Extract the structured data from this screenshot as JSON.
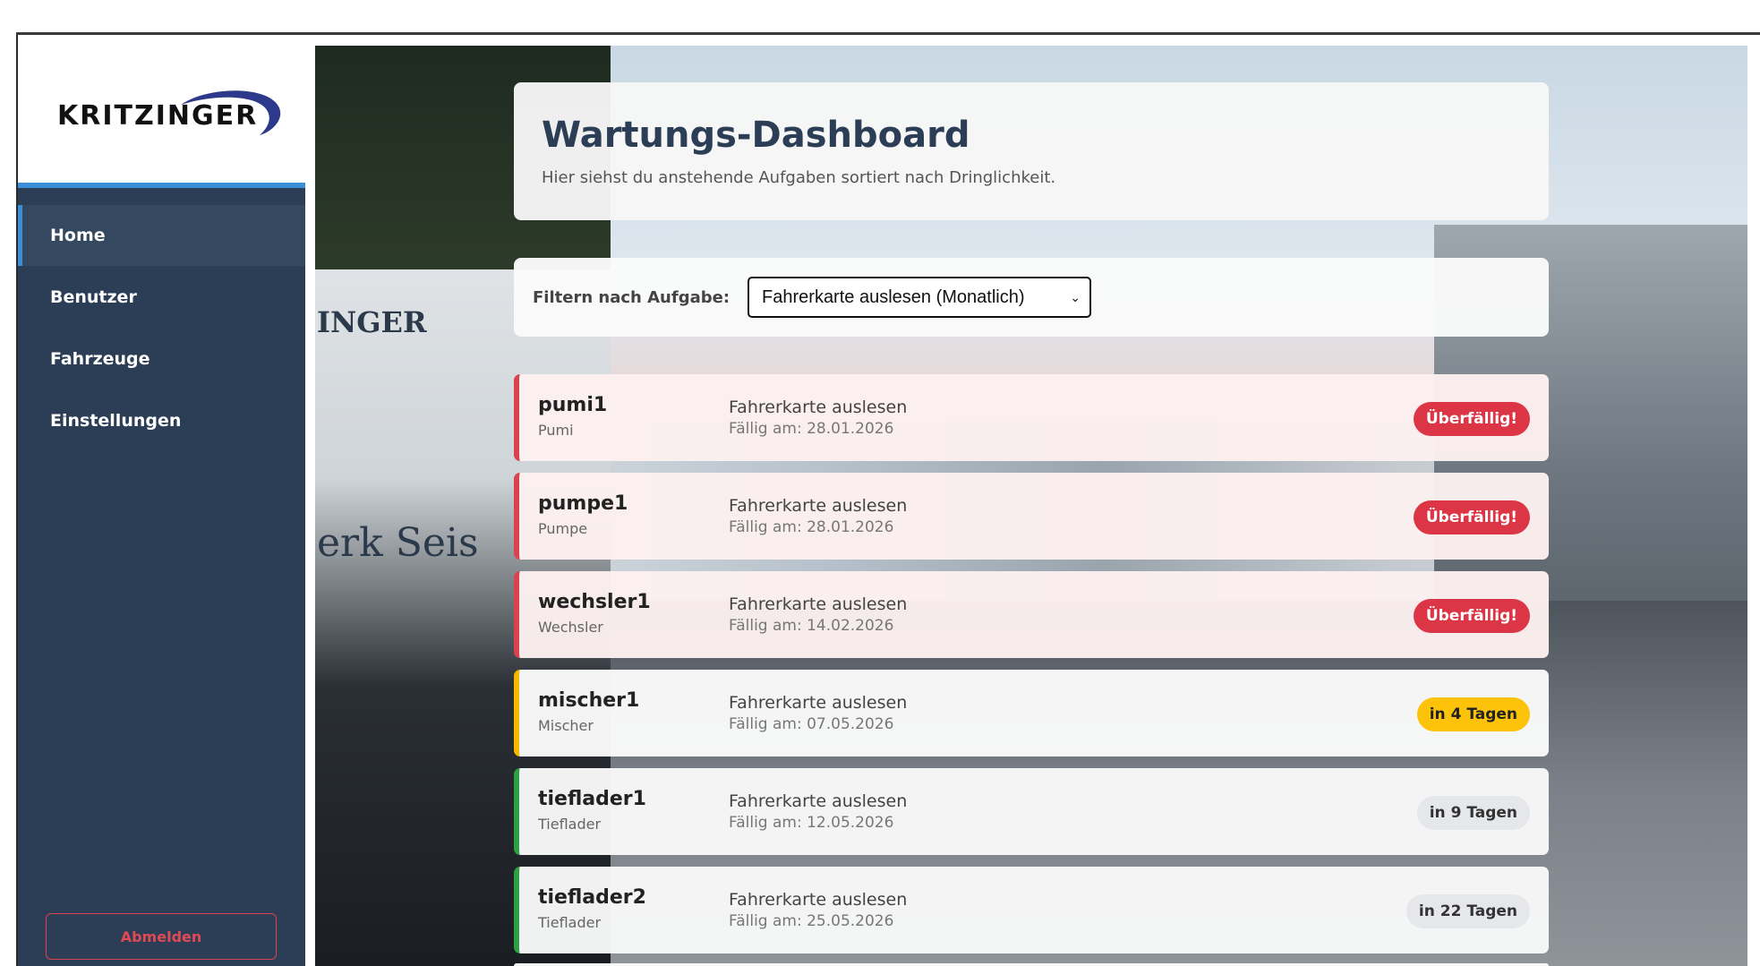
{
  "brand": {
    "logo_text": "KRITZINGER"
  },
  "sidebar": {
    "items": [
      {
        "label": "Home"
      },
      {
        "label": "Benutzer"
      },
      {
        "label": "Fahrzeuge"
      },
      {
        "label": "Einstellungen"
      }
    ],
    "logout_label": "Abmelden"
  },
  "background": {
    "truck_text_1": "INGER",
    "truck_text_2": "erk Seis"
  },
  "header": {
    "title": "Wartungs-Dashboard",
    "subtitle": "Hier siehst du anstehende Aufgaben sortiert nach Dringlichkeit."
  },
  "filter": {
    "label": "Filtern nach Aufgabe:",
    "selected": "Fahrerkarte auslesen (Monatlich)"
  },
  "tasks": [
    {
      "name": "pumi1",
      "type": "Pumi",
      "task": "Fahrerkarte auslesen",
      "due": "Fällig am: 28.01.2026",
      "status": "Überfällig!"
    },
    {
      "name": "pumpe1",
      "type": "Pumpe",
      "task": "Fahrerkarte auslesen",
      "due": "Fällig am: 28.01.2026",
      "status": "Überfällig!"
    },
    {
      "name": "wechsler1",
      "type": "Wechsler",
      "task": "Fahrerkarte auslesen",
      "due": "Fällig am: 14.02.2026",
      "status": "Überfällig!"
    },
    {
      "name": "mischer1",
      "type": "Mischer",
      "task": "Fahrerkarte auslesen",
      "due": "Fällig am: 07.05.2026",
      "status": "in 4 Tagen"
    },
    {
      "name": "tieflader1",
      "type": "Tieflader",
      "task": "Fahrerkarte auslesen",
      "due": "Fällig am: 12.05.2026",
      "status": "in 9 Tagen"
    },
    {
      "name": "tieflader2",
      "type": "Tieflader",
      "task": "Fahrerkarte auslesen",
      "due": "Fällig am: 25.05.2026",
      "status": "in 22 Tagen"
    }
  ],
  "colors": {
    "sidebar_bg": "#2c3e55",
    "accent": "#3a8fd6",
    "overdue": "#dc3545",
    "soon": "#fcc30a",
    "ok": "#2ea043"
  }
}
